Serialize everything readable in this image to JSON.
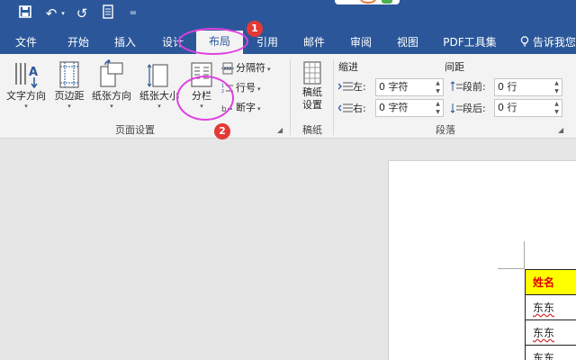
{
  "quick_access": {
    "undo_glyph": "↶",
    "redo_glyph": "↺",
    "more_glyph": "="
  },
  "tabs": [
    {
      "label": "文件"
    },
    {
      "label": "开始"
    },
    {
      "label": "插入"
    },
    {
      "label": "设计"
    },
    {
      "label": "布局",
      "active": true
    },
    {
      "label": "引用"
    },
    {
      "label": "邮件"
    },
    {
      "label": "审阅"
    },
    {
      "label": "视图"
    },
    {
      "label": "PDF工具集"
    },
    {
      "label": "告诉我您"
    }
  ],
  "ribbon": {
    "page_setup": {
      "group_label": "页面设置",
      "text_direction": "文字方向",
      "margins": "页边距",
      "orientation": "纸张方向",
      "size": "纸张大小",
      "columns": "分栏",
      "breaks": "分隔符",
      "line_numbers": "行号",
      "hyphenation": "断字"
    },
    "manuscript": {
      "group_label": "稿纸",
      "button_line1": "稿纸",
      "button_line2": "设置"
    },
    "paragraph": {
      "group_label": "段落",
      "indent_title": "缩进",
      "spacing_title": "间距",
      "indent_left_label": "左:",
      "indent_left_value": "0 字符",
      "indent_right_label": "右:",
      "indent_right_value": "0 字符",
      "spacing_before_label": "段前:",
      "spacing_before_value": "0 行",
      "spacing_after_label": "段后:",
      "spacing_after_value": "0 行"
    }
  },
  "annotations": {
    "badge1": "1",
    "badge2": "2",
    "color": "#e040e0",
    "badge_color": "#e53935"
  },
  "document": {
    "table_header": "姓名",
    "rows": [
      "东东",
      "东东",
      "东东"
    ]
  },
  "colors": {
    "brand": "#2b579a",
    "ribbon_bg": "#f3f3f3",
    "canvas_bg": "#e6e6e6",
    "header_fill": "#ffff00",
    "header_text": "#e00000"
  }
}
